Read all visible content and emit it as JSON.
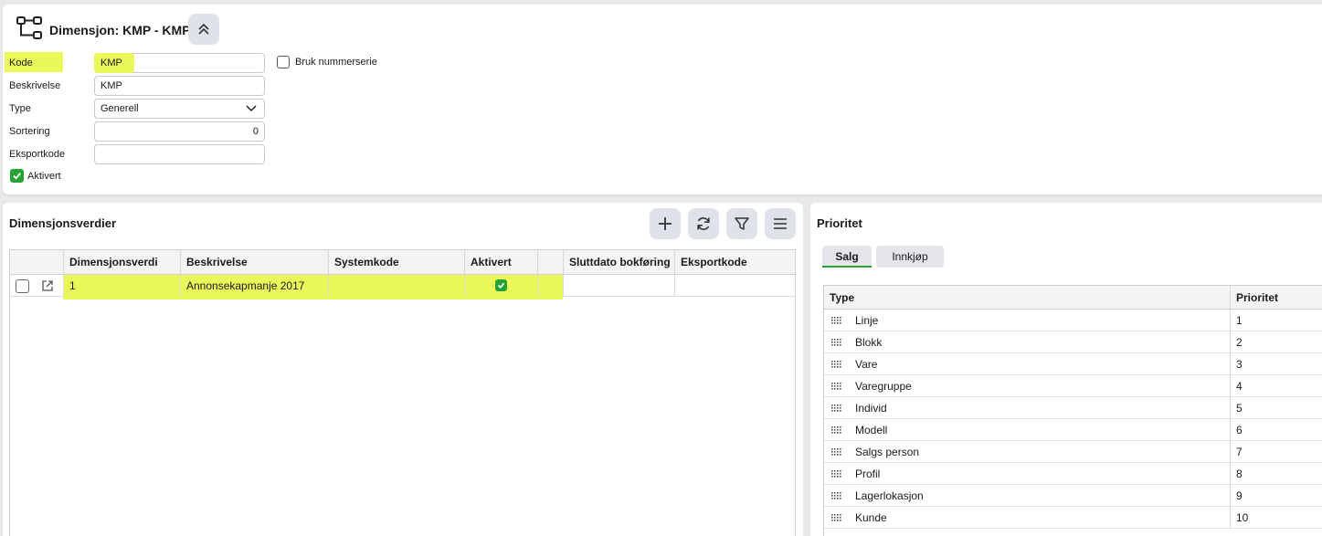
{
  "header": {
    "icon": "hierarchy-icon",
    "title": "Dimensjon: KMP - KMP",
    "collapse_icon": "chevron-double-up-icon"
  },
  "form": {
    "kode_label": "Kode",
    "kode_value": "KMP",
    "bruk_nummerserie_label": "Bruk nummerserie",
    "bruk_nummerserie_checked": false,
    "beskrivelse_label": "Beskrivelse",
    "beskrivelse_value": "KMP",
    "type_label": "Type",
    "type_value": "Generell",
    "sortering_label": "Sortering",
    "sortering_value": "0",
    "eksportkode_label": "Eksportkode",
    "eksportkode_value": "",
    "aktivert_label": "Aktivert",
    "aktivert_checked": true
  },
  "dimensjonsverdier": {
    "title": "Dimensjonsverdier",
    "toolbar": {
      "add_icon": "plus-icon",
      "refresh_icon": "refresh-icon",
      "filter_icon": "filter-icon",
      "menu_icon": "hamburger-menu-icon"
    },
    "columns": [
      "Dimensjonsverdi",
      "Beskrivelse",
      "Systemkode",
      "Aktivert",
      "Sluttdato bokføring",
      "Eksportkode"
    ],
    "rows": [
      {
        "dimensjonsverdi": "1",
        "beskrivelse": "Annonsekapmanje 2017",
        "systemkode": "",
        "aktivert": true,
        "sluttdato": "",
        "eksportkode": ""
      }
    ]
  },
  "prioritet": {
    "title": "Prioritet",
    "tabs": [
      {
        "label": "Salg",
        "active": true
      },
      {
        "label": "Innkjøp",
        "active": false
      }
    ],
    "columns": [
      "Type",
      "Prioritet"
    ],
    "rows": [
      {
        "type": "Linje",
        "prioritet": "1"
      },
      {
        "type": "Blokk",
        "prioritet": "2"
      },
      {
        "type": "Vare",
        "prioritet": "3"
      },
      {
        "type": "Varegruppe",
        "prioritet": "4"
      },
      {
        "type": "Individ",
        "prioritet": "5"
      },
      {
        "type": "Modell",
        "prioritet": "6"
      },
      {
        "type": "Salgs person",
        "prioritet": "7"
      },
      {
        "type": "Profil",
        "prioritet": "8"
      },
      {
        "type": "Lagerlokasjon",
        "prioritet": "9"
      },
      {
        "type": "Kunde",
        "prioritet": "10"
      }
    ]
  },
  "colors": {
    "highlight": "#ebf85a",
    "accent_green": "#26a334",
    "button_bg": "#dfe2e8"
  }
}
